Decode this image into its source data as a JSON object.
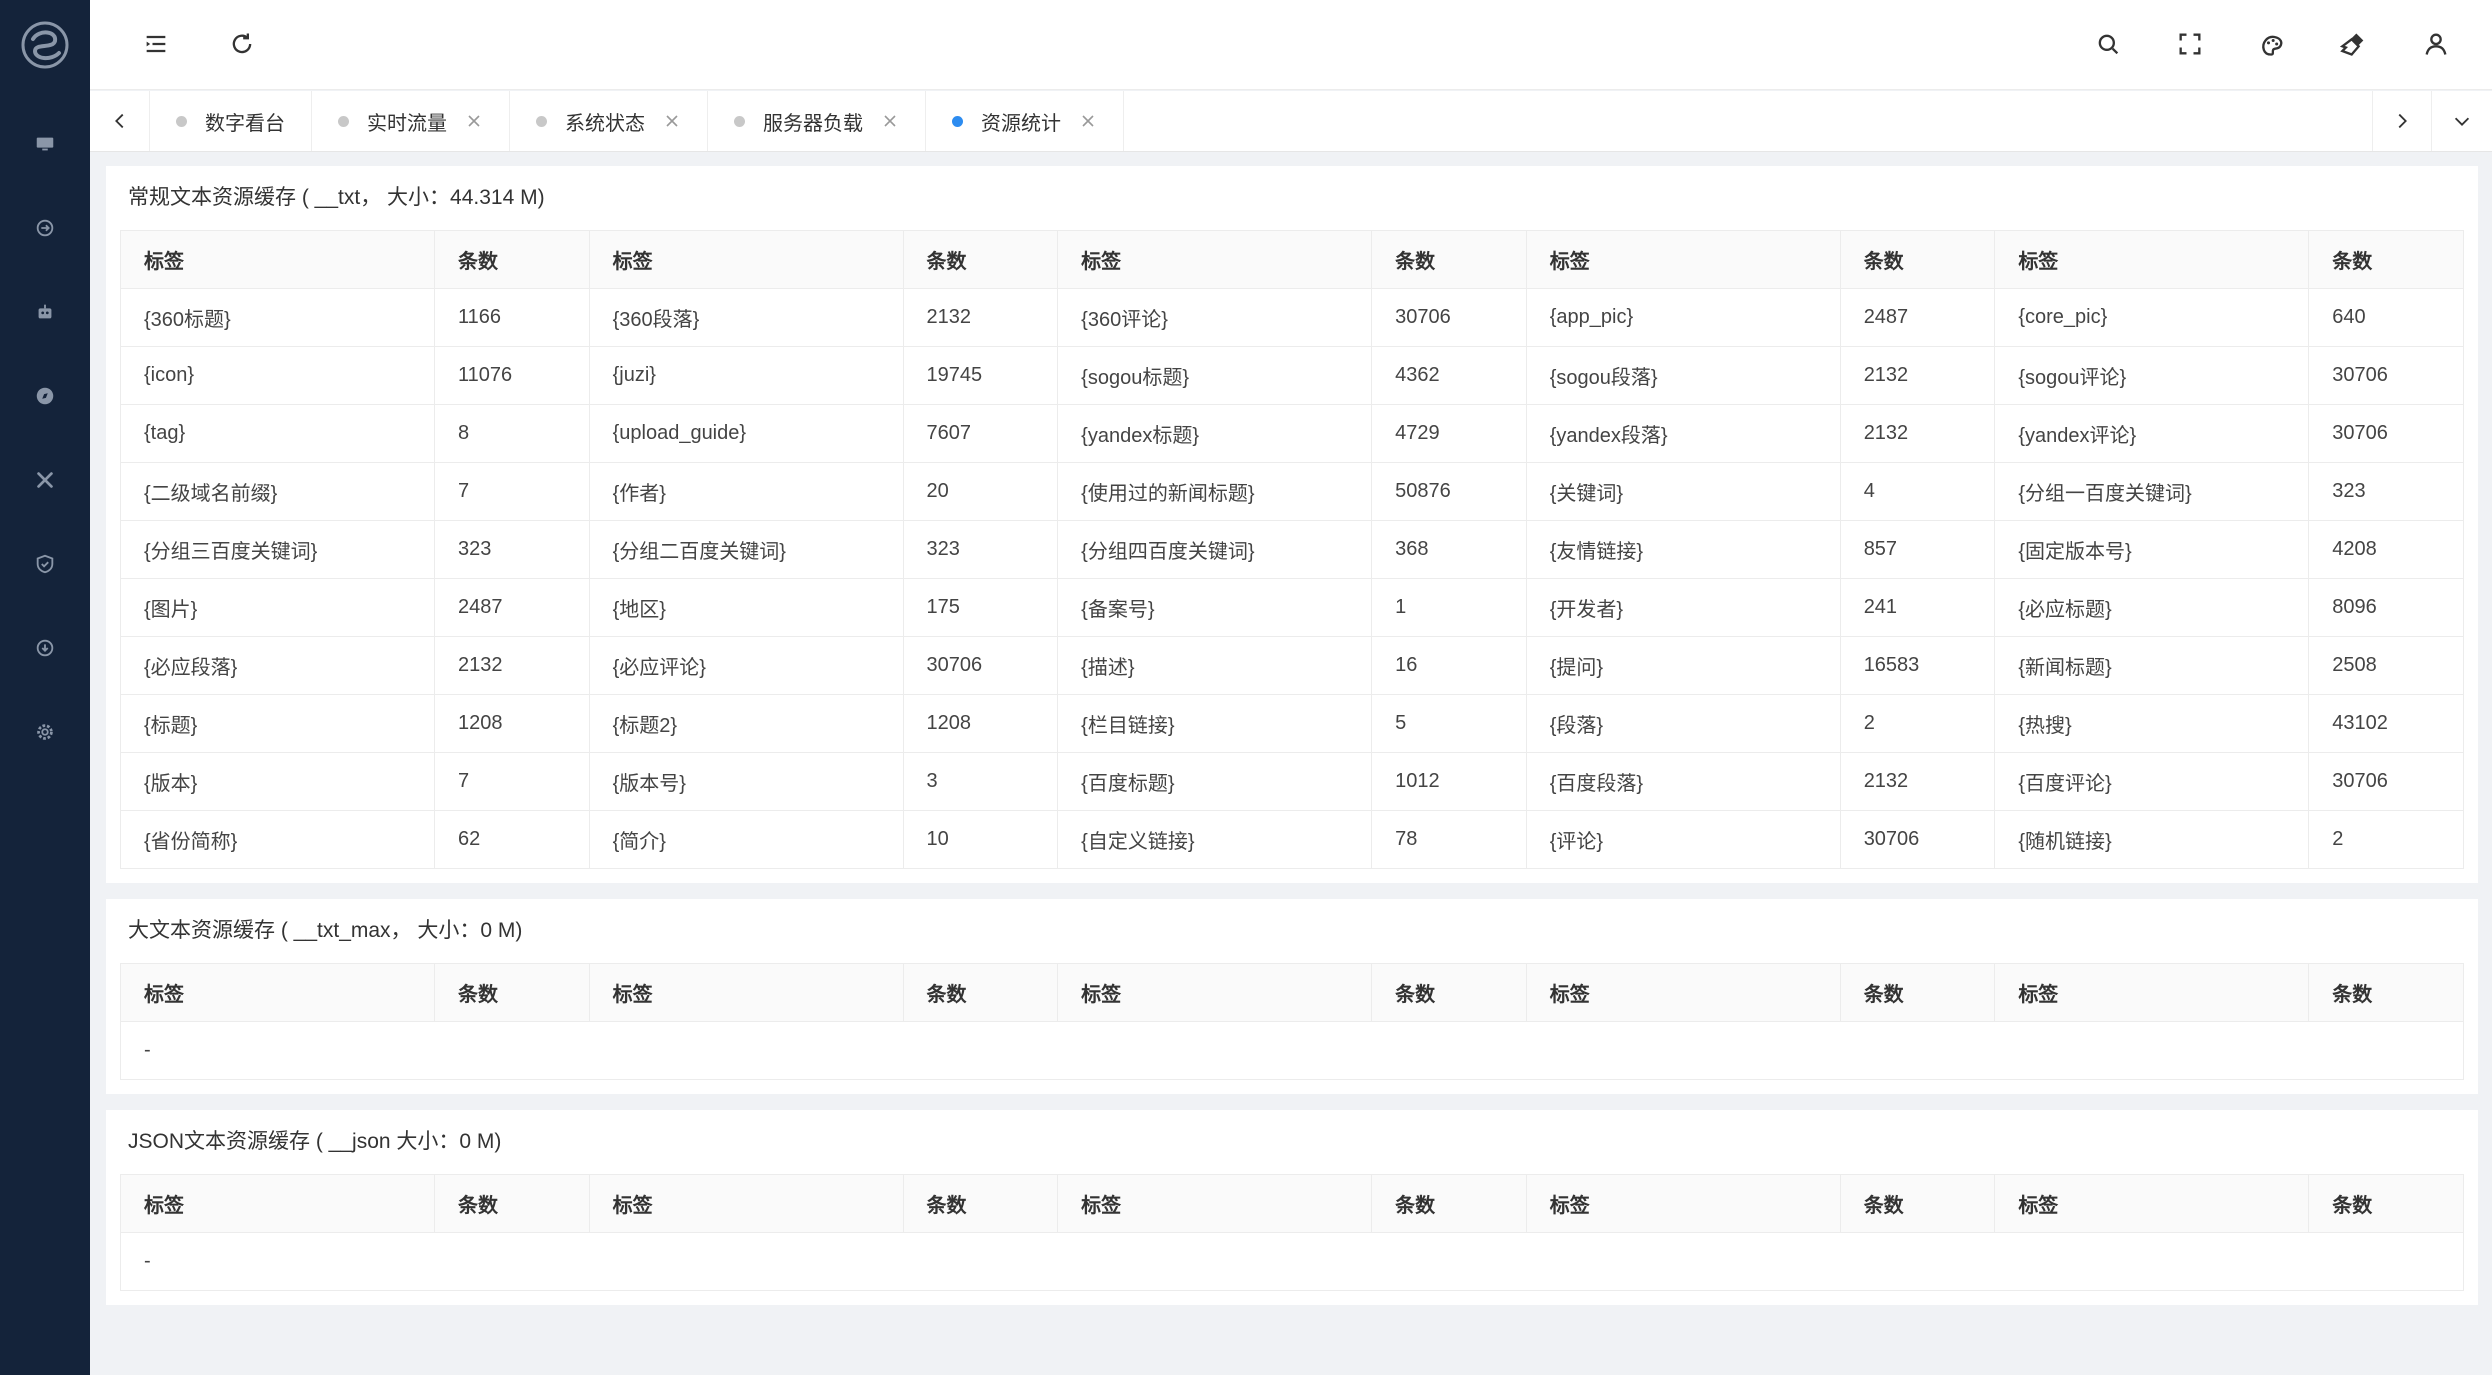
{
  "header": {
    "menu_toggle_icon": "menu-fold-icon",
    "refresh_icon": "refresh-icon",
    "right_icons": [
      "search-icon",
      "fullscreen-icon",
      "theme-icon",
      "clear-cache-icon",
      "user-icon"
    ]
  },
  "tabs": [
    {
      "label": "数字看台",
      "active": false,
      "closable": false
    },
    {
      "label": "实时流量",
      "active": false,
      "closable": true
    },
    {
      "label": "系统状态",
      "active": false,
      "closable": true
    },
    {
      "label": "服务器负载",
      "active": false,
      "closable": true
    },
    {
      "label": "资源统计",
      "active": true,
      "closable": true
    }
  ],
  "accent_color": "#2d8cf0",
  "sidebar_bg": "#14233a",
  "col_headers": {
    "label": "标签",
    "count": "条数"
  },
  "cards": [
    {
      "title": "常规文本资源缓存 ( __txt， 大小：44.314 M)",
      "rows": [
        [
          [
            "{360标题}",
            "1166"
          ],
          [
            "{360段落}",
            "2132"
          ],
          [
            "{360评论}",
            "30706"
          ],
          [
            "{app_pic}",
            "2487"
          ],
          [
            "{core_pic}",
            "640"
          ]
        ],
        [
          [
            "{icon}",
            "11076"
          ],
          [
            "{juzi}",
            "19745"
          ],
          [
            "{sogou标题}",
            "4362"
          ],
          [
            "{sogou段落}",
            "2132"
          ],
          [
            "{sogou评论}",
            "30706"
          ]
        ],
        [
          [
            "{tag}",
            "8"
          ],
          [
            "{upload_guide}",
            "7607"
          ],
          [
            "{yandex标题}",
            "4729"
          ],
          [
            "{yandex段落}",
            "2132"
          ],
          [
            "{yandex评论}",
            "30706"
          ]
        ],
        [
          [
            "{二级域名前缀}",
            "7"
          ],
          [
            "{作者}",
            "20"
          ],
          [
            "{使用过的新闻标题}",
            "50876"
          ],
          [
            "{关键词}",
            "4"
          ],
          [
            "{分组一百度关键词}",
            "323"
          ]
        ],
        [
          [
            "{分组三百度关键词}",
            "323"
          ],
          [
            "{分组二百度关键词}",
            "323"
          ],
          [
            "{分组四百度关键词}",
            "368"
          ],
          [
            "{友情链接}",
            "857"
          ],
          [
            "{固定版本号}",
            "4208"
          ]
        ],
        [
          [
            "{图片}",
            "2487"
          ],
          [
            "{地区}",
            "175"
          ],
          [
            "{备案号}",
            "1"
          ],
          [
            "{开发者}",
            "241"
          ],
          [
            "{必应标题}",
            "8096"
          ]
        ],
        [
          [
            "{必应段落}",
            "2132"
          ],
          [
            "{必应评论}",
            "30706"
          ],
          [
            "{描述}",
            "16"
          ],
          [
            "{提问}",
            "16583"
          ],
          [
            "{新闻标题}",
            "2508"
          ]
        ],
        [
          [
            "{标题}",
            "1208"
          ],
          [
            "{标题2}",
            "1208"
          ],
          [
            "{栏目链接}",
            "5"
          ],
          [
            "{段落}",
            "2"
          ],
          [
            "{热搜}",
            "43102"
          ]
        ],
        [
          [
            "{版本}",
            "7"
          ],
          [
            "{版本号}",
            "3"
          ],
          [
            "{百度标题}",
            "1012"
          ],
          [
            "{百度段落}",
            "2132"
          ],
          [
            "{百度评论}",
            "30706"
          ]
        ],
        [
          [
            "{省份简称}",
            "62"
          ],
          [
            "{简介}",
            "10"
          ],
          [
            "{自定义链接}",
            "78"
          ],
          [
            "{评论}",
            "30706"
          ],
          [
            "{随机链接}",
            "2"
          ]
        ]
      ],
      "empty_text": ""
    },
    {
      "title": "大文本资源缓存 ( __txt_max， 大小：0 M)",
      "rows": [],
      "empty_text": "-"
    },
    {
      "title": "JSON文本资源缓存 ( __json 大小：0 M)",
      "rows": [],
      "empty_text": "-"
    }
  ]
}
